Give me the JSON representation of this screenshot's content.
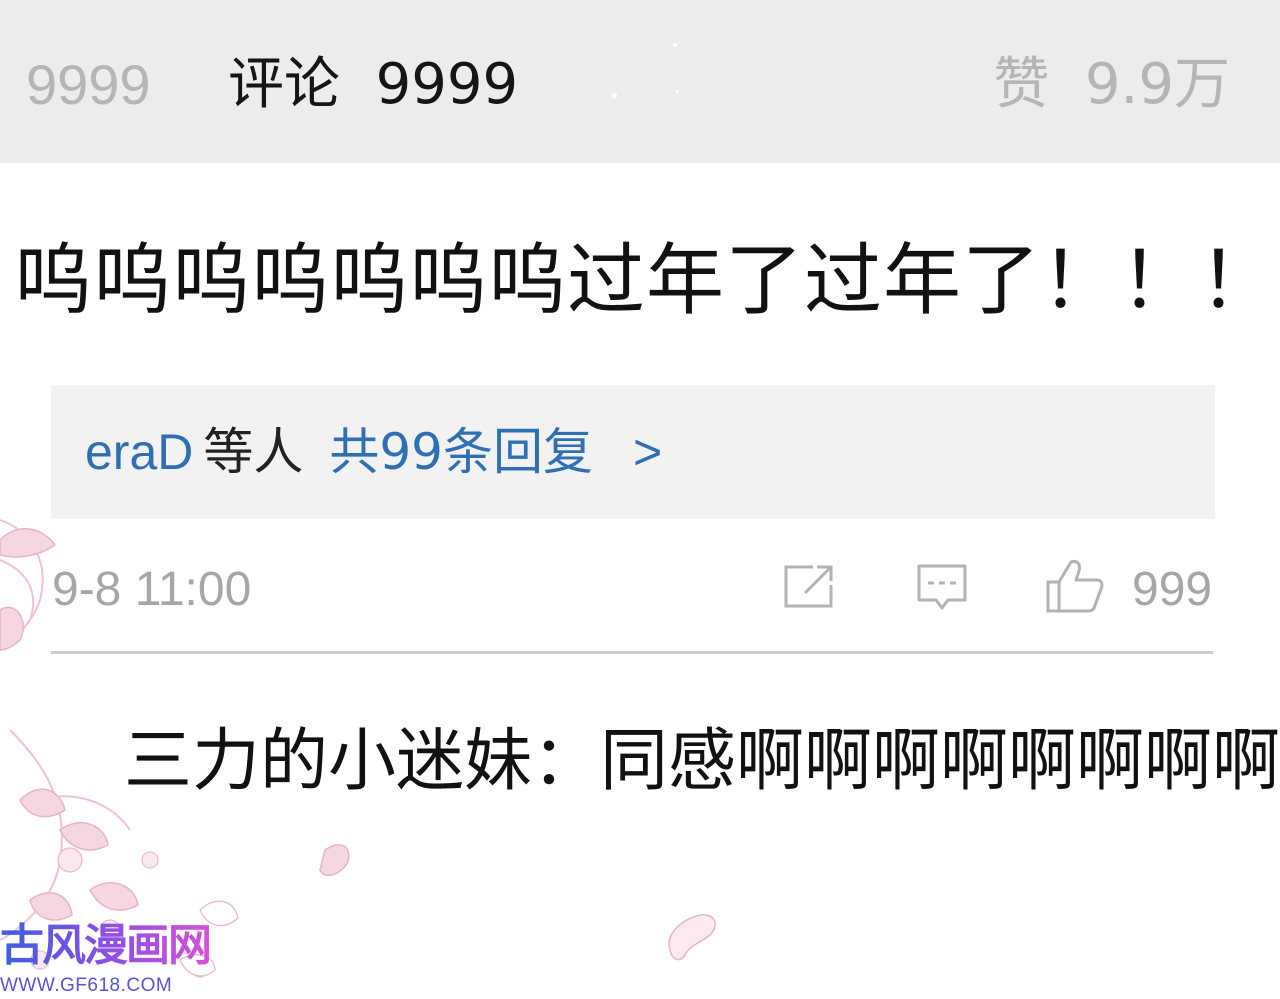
{
  "stats_bar": {
    "repost_count": "9999",
    "comment_tab": "评论  9999",
    "like_count": "赞  9.9万"
  },
  "main_comment": {
    "text": "呜呜呜呜呜呜呜过年了过年了！！！"
  },
  "replies": {
    "user": "eraD",
    "others": "等人",
    "total": "共99条回复",
    "arrow": ">"
  },
  "meta": {
    "timestamp": "9-8 11:00",
    "like_count": "999",
    "icons": [
      "share-icon",
      "reply-icon",
      "thumbs-up-icon"
    ]
  },
  "sub_reply": {
    "text": "三力的小迷妹：同感啊啊啊啊啊啊啊啊"
  },
  "watermark": {
    "logo": "古风漫画网",
    "url": "WWW.GF618.COM"
  },
  "colors": {
    "link_blue": "#2f6fb5",
    "muted_gray": "#a6a6a6",
    "bar_gray": "#ececec",
    "deco_pink": "#f2c6d6"
  }
}
